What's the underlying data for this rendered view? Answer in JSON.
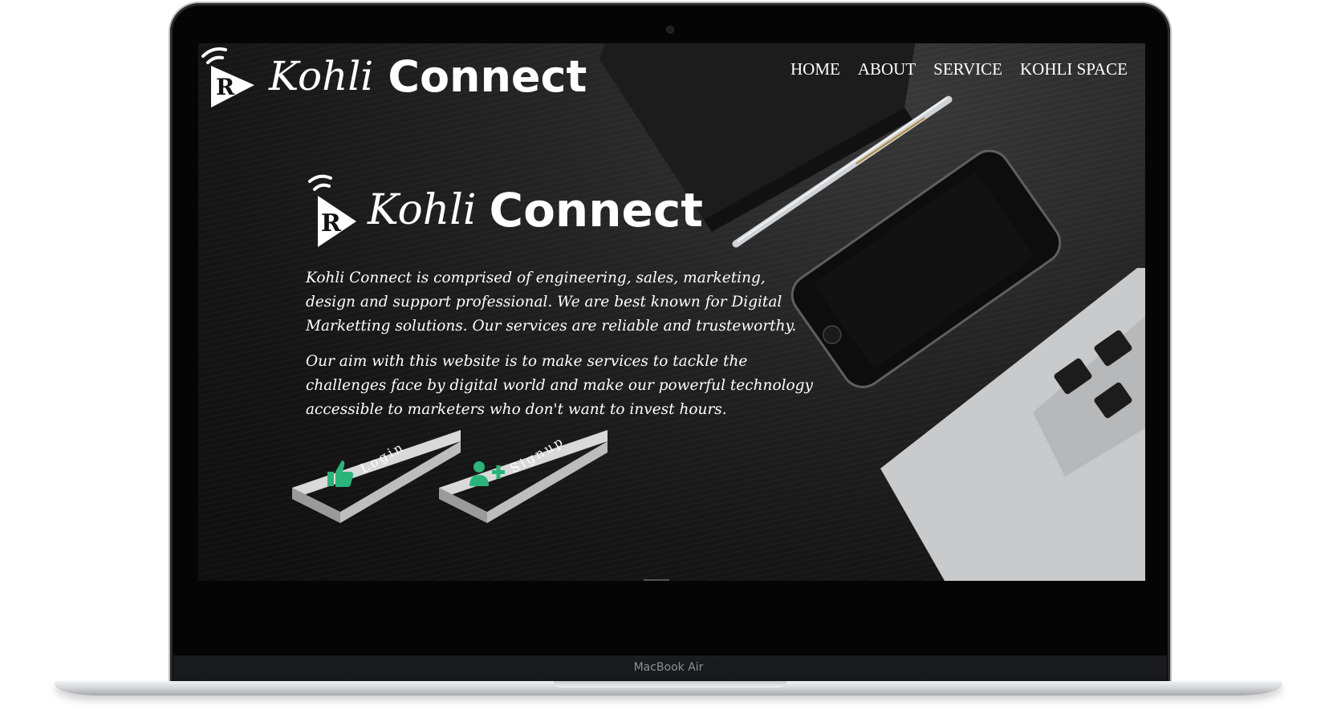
{
  "device": {
    "model_label": "MacBook Air"
  },
  "header": {
    "logo": {
      "kohli": "Kohli",
      "connect": "Connect"
    },
    "nav": [
      "HOME",
      "ABOUT",
      "SERVICE",
      "KOHLI SPACE"
    ]
  },
  "hero": {
    "logo": {
      "kohli": "Kohli",
      "connect": "Connect"
    },
    "paragraphs": [
      "Kohli Connect is comprised of engineering, sales, marketing, design and support professional. We are best known for Digital Marketting solutions. Our services are reliable and trusteworthy.",
      "Our aim with this website is to make services to tackle the challenges face by digital world and make our powerful technology accessible to marketers who don't want to invest hours."
    ],
    "buttons": {
      "login": "Login",
      "signup": "Signup"
    }
  },
  "colors": {
    "accent": "#2bb37a",
    "text": "#ffffff",
    "background": "#1b1b1b"
  },
  "icons": [
    "thumbs-up-icon",
    "add-user-icon",
    "wifi-play-logo-icon"
  ]
}
